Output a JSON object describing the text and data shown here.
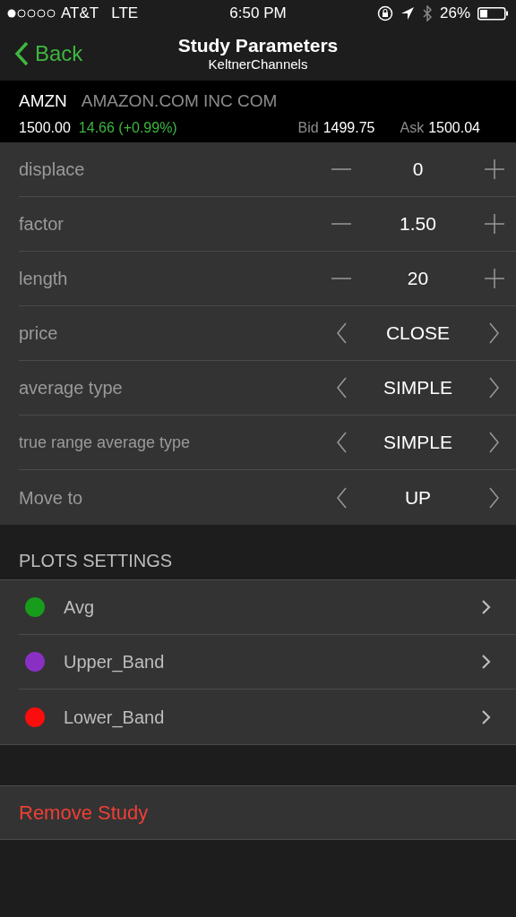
{
  "status_bar": {
    "carrier": "AT&T",
    "network": "LTE",
    "time": "6:50 PM",
    "battery": "26%"
  },
  "nav": {
    "back": "Back",
    "title": "Study Parameters",
    "subtitle": "KeltnerChannels"
  },
  "quote": {
    "symbol": "AMZN",
    "name": "AMAZON.COM INC COM",
    "last": "1500.00",
    "change": "14.66 (+0.99%)",
    "bid_label": "Bid",
    "bid": "1499.75",
    "ask_label": "Ask",
    "ask": "1500.04"
  },
  "parameters": [
    {
      "label": "displace",
      "kind": "stepper",
      "value": "0"
    },
    {
      "label": "factor",
      "kind": "stepper",
      "value": "1.50"
    },
    {
      "label": "length",
      "kind": "stepper",
      "value": "20"
    },
    {
      "label": "price",
      "kind": "picker",
      "value": "CLOSE"
    },
    {
      "label": "average type",
      "kind": "picker",
      "value": "SIMPLE"
    },
    {
      "label": "true range average type",
      "kind": "picker",
      "value": "SIMPLE"
    },
    {
      "label": "Move to",
      "kind": "picker",
      "value": "UP"
    }
  ],
  "plots_settings": {
    "header": "PLOTS SETTINGS",
    "items": [
      {
        "name": "Avg",
        "color": "#179c1b"
      },
      {
        "name": "Upper_Band",
        "color": "#8a2fc4"
      },
      {
        "name": "Lower_Band",
        "color": "#fb0d0d"
      }
    ]
  },
  "remove_button": "Remove Study"
}
